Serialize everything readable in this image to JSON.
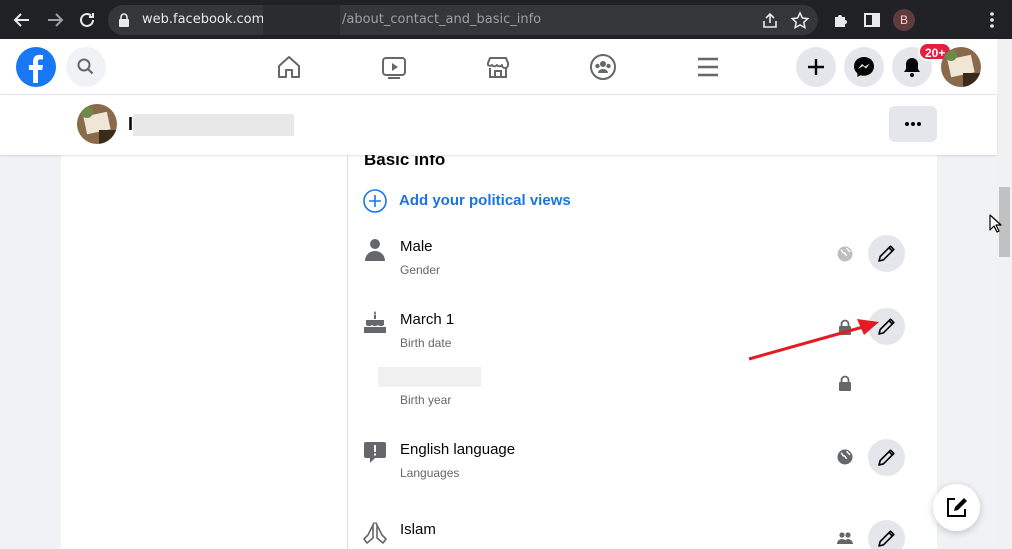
{
  "browser": {
    "url_domain": "web.facebook.com/",
    "url_path": "/about_contact_and_basic_info",
    "profile_initial": "B"
  },
  "topbar": {
    "notification_count": "20+"
  },
  "profile": {
    "name_initial": "I"
  },
  "section": {
    "title": "Basic info",
    "add_label": "Add your political views"
  },
  "rows": [
    {
      "value": "Male",
      "label": "Gender",
      "icon": "person-icon",
      "privacy": "globe-icon"
    },
    {
      "value": "March 1",
      "label": "Birth date",
      "icon": "cake-icon",
      "privacy": "lock-icon"
    },
    {
      "value": "",
      "label": "Birth year",
      "icon": "",
      "privacy": "lock-icon"
    },
    {
      "value": "English language",
      "label": "Languages",
      "icon": "speech-bubble-icon",
      "privacy": "globe-icon"
    },
    {
      "value": "Islam",
      "label": "",
      "icon": "praying-hands-icon",
      "privacy": "friends-icon"
    }
  ],
  "colors": {
    "brand": "#1877f2",
    "link": "#1b74e4",
    "annotation_arrow": "#e31b23",
    "badge": "#e41e3f"
  }
}
